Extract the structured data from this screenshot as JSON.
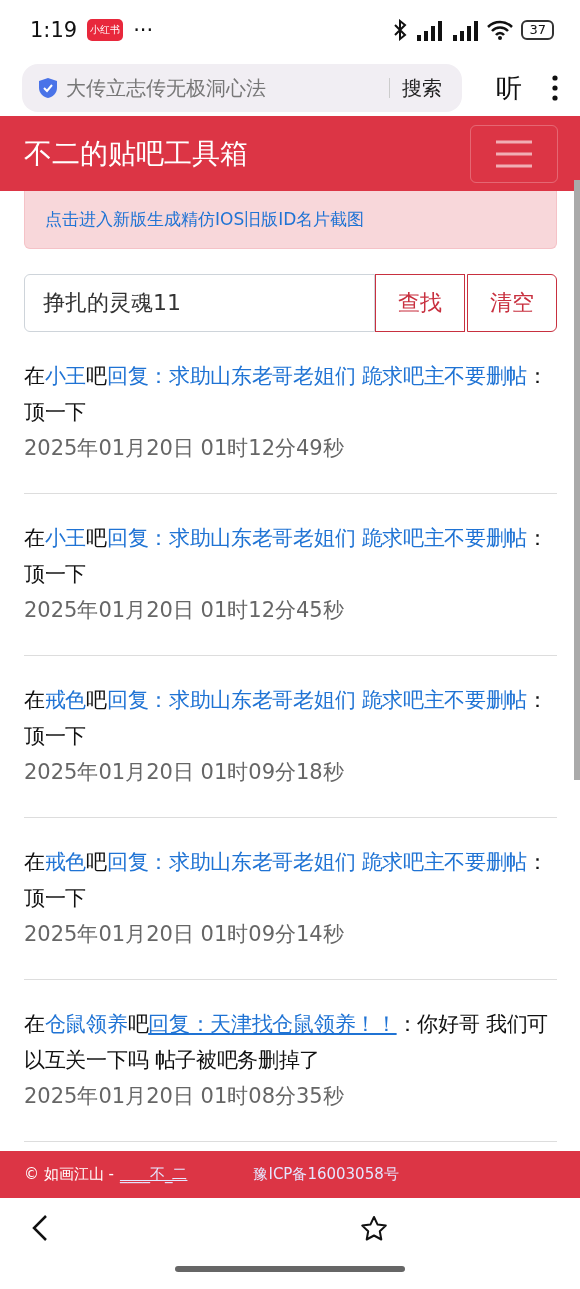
{
  "status_bar": {
    "time": "1:19",
    "app_badge": "小红书",
    "more": "···",
    "battery": "37"
  },
  "browser_bar": {
    "address": "大传立志传无极洞心法",
    "search_button": "搜索",
    "listen_button": "听"
  },
  "header": {
    "title": "不二的贴吧工具箱"
  },
  "alert": {
    "link": "点击进入新版生成精仿IOS旧版ID名片截图"
  },
  "search": {
    "value": "挣扎的灵魂11",
    "find_button": "查找",
    "clear_button": "清空"
  },
  "posts": [
    {
      "prefix": "在",
      "forum": "小王",
      "suffix": "吧",
      "thread": "回复：求助山东老哥老姐们 跪求吧主不要删帖",
      "underlined": false,
      "separator": "：",
      "content": "顶一下",
      "time": "2025年01月20日 01时12分49秒"
    },
    {
      "prefix": "在",
      "forum": "小王",
      "suffix": "吧",
      "thread": "回复：求助山东老哥老姐们 跪求吧主不要删帖",
      "underlined": false,
      "separator": "：",
      "content": "顶一下",
      "time": "2025年01月20日 01时12分45秒"
    },
    {
      "prefix": "在",
      "forum": "戒色",
      "suffix": "吧",
      "thread": "回复：求助山东老哥老姐们 跪求吧主不要删帖",
      "underlined": false,
      "separator": "：",
      "content": "顶一下",
      "time": "2025年01月20日 01时09分18秒"
    },
    {
      "prefix": "在",
      "forum": "戒色",
      "suffix": "吧",
      "thread": "回复：求助山东老哥老姐们 跪求吧主不要删帖",
      "underlined": false,
      "separator": "：",
      "content": "顶一下",
      "time": "2025年01月20日 01时09分14秒"
    },
    {
      "prefix": "在",
      "forum": "仓鼠领养",
      "suffix": "吧",
      "thread": "回复：天津找仓鼠领养！！",
      "underlined": true,
      "separator": "：",
      "content": "你好哥 我们可以互关一下吗 帖子被吧务删掉了",
      "time": "2025年01月20日 01时08分35秒"
    }
  ],
  "footer": {
    "copyright": "© 如画江山 -",
    "author_link": "____不_二",
    "icp_link": "豫ICP备16003058号"
  }
}
